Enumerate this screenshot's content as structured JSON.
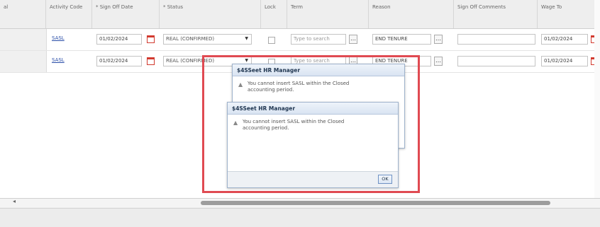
{
  "headers": {
    "activity_code": "Activity Code",
    "sign_off_date": "* Sign Off Date",
    "status": "* Status",
    "lock": "Lock",
    "term": "Term",
    "reason": "Reason",
    "sign_off_comments": "Sign Off Comments",
    "wage_to": "Wage To"
  },
  "rows": [
    {
      "activity_code": "SASL",
      "sign_off_date": "01/02/2024",
      "status": "REAL (CONFIRMED)",
      "term_placeholder": "Type to search",
      "reason": "END TENURE",
      "sign_off_comments": "",
      "wage_to": "01/02/2024"
    },
    {
      "activity_code": "SASL",
      "sign_off_date": "01/02/2024",
      "status": "REAL (CONFIRMED)",
      "term_placeholder": "Type to search",
      "reason": "END TENURE",
      "sign_off_comments": "",
      "wage_to": "01/02/2024"
    }
  ],
  "dialogs": [
    {
      "title": "$4SSeet HR Manager",
      "message_line1": "You cannot insert SASL within the Closed",
      "message_line2": "accounting period."
    },
    {
      "title": "$4SSeet HR Manager",
      "message_line1": "You cannot insert SASL within the Closed",
      "message_line2": "accounting period.",
      "ok_label": "OK"
    }
  ],
  "colors": {
    "highlight": "#e04a52",
    "link": "#2a4ea8",
    "calendar_icon": "#d23a2f"
  },
  "icons": {
    "calendar": "calendar-icon",
    "dropdown": "chevron-down-icon",
    "lookup": "ellipsis-icon",
    "warning": "warning-icon",
    "scroll_left": "scroll-left-arrow-icon"
  }
}
